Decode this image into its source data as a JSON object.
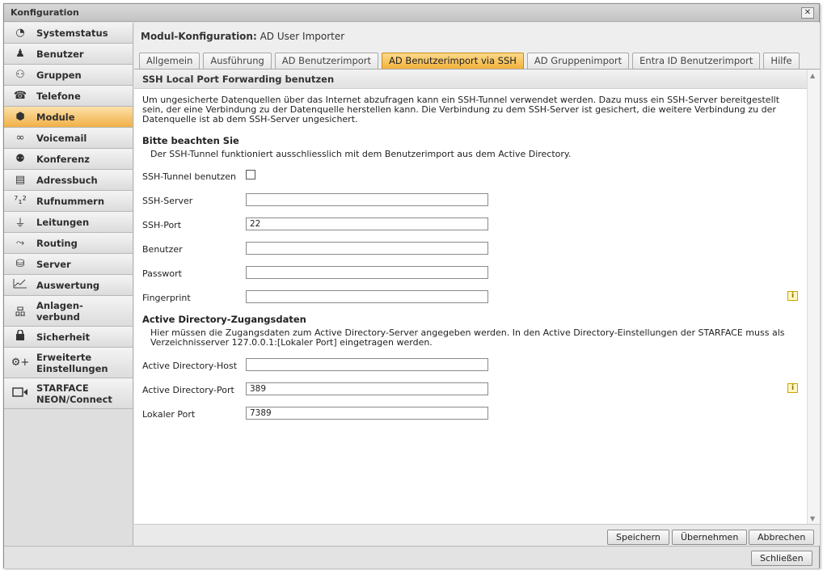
{
  "window": {
    "title": "Konfiguration",
    "close_glyph": "✕"
  },
  "sidebar": {
    "items": [
      {
        "label": "Systemstatus",
        "icon": "pie-chart-icon",
        "glyph": "◔"
      },
      {
        "label": "Benutzer",
        "icon": "user-icon",
        "glyph": "♟"
      },
      {
        "label": "Gruppen",
        "icon": "group-icon",
        "glyph": "⚇"
      },
      {
        "label": "Telefone",
        "icon": "phone-icon",
        "glyph": "☎"
      },
      {
        "label": "Module",
        "icon": "module-cube-icon",
        "glyph": "⬢"
      },
      {
        "label": "Voicemail",
        "icon": "voicemail-icon",
        "glyph": "∞"
      },
      {
        "label": "Konferenz",
        "icon": "conference-icon",
        "glyph": "⚉"
      },
      {
        "label": "Adressbuch",
        "icon": "address-book-icon",
        "glyph": "▤"
      },
      {
        "label": "Rufnummern",
        "icon": "phone-numbers-icon",
        "glyph": "⁷₁²"
      },
      {
        "label": "Leitungen",
        "icon": "lines-plug-icon",
        "glyph": "⏚"
      },
      {
        "label": "Routing",
        "icon": "routing-icon",
        "glyph": "⤳"
      },
      {
        "label": "Server",
        "icon": "server-icon",
        "glyph": "⛁"
      },
      {
        "label": "Auswertung",
        "icon": "statistics-icon",
        "glyph": "📈"
      },
      {
        "label": "Anlagen-\nverbund",
        "icon": "network-icon",
        "glyph": "品"
      },
      {
        "label": "Sicherheit",
        "icon": "lock-icon",
        "glyph": "🔒"
      },
      {
        "label": "Erweiterte\nEinstellungen",
        "icon": "advanced-settings-icon",
        "glyph": "⚙+"
      },
      {
        "label": "STARFACE\nNEON/Connect",
        "icon": "video-camera-icon",
        "glyph": "▭◁"
      }
    ]
  },
  "main": {
    "header_label": "Modul-Konfiguration:",
    "header_value": "AD User Importer",
    "tabs": [
      "Allgemein",
      "Ausführung",
      "AD Benutzerimport",
      "AD Benutzerimport via SSH",
      "AD Gruppenimport",
      "Entra ID Benutzerimport",
      "Hilfe"
    ],
    "active_tab": "AD Benutzerimport via SSH",
    "section_title": "SSH Local Port Forwarding benutzen",
    "intro": "Um ungesicherte Datenquellen über das Internet abzufragen kann ein SSH-Tunnel verwendet werden. Dazu muss ein SSH-Server bereitgestellt sein, der eine Verbindung zu der Datenquelle herstellen kann. Die Verbindung zu dem SSH-Server ist gesichert, die weitere Verbindung zu der Datenquelle ist ab dem SSH-Server ungesichert.",
    "notice_title": "Bitte beachten Sie",
    "notice_text": "Der SSH-Tunnel funktioniert ausschliesslich mit dem Benutzerimport aus dem Active Directory.",
    "ssh_tunnel_label": "SSH-Tunnel benutzen",
    "ssh_tunnel_checked": false,
    "fields": {
      "ssh_server": {
        "label": "SSH-Server",
        "value": ""
      },
      "ssh_port": {
        "label": "SSH-Port",
        "value": "22"
      },
      "user": {
        "label": "Benutzer",
        "value": ""
      },
      "password": {
        "label": "Passwort",
        "value": ""
      },
      "fingerprint": {
        "label": "Fingerprint",
        "value": ""
      },
      "ad_host": {
        "label": "Active Directory-Host",
        "value": ""
      },
      "ad_port": {
        "label": "Active Directory-Port",
        "value": "389"
      },
      "local_port": {
        "label": "Lokaler Port",
        "value": "7389"
      }
    },
    "ad_title": "Active Directory-Zugangsdaten",
    "ad_text": "Hier müssen die Zugangsdaten zum Active Directory-Server angegeben werden. In den Active Directory-Einstellungen der STARFACE muss als Verzeichnisserver 127.0.0.1:[Lokaler Port] eingetragen werden.",
    "info_glyph": "i",
    "buttons": {
      "save": "Speichern",
      "apply": "Übernehmen",
      "cancel": "Abbrechen"
    }
  },
  "footer": {
    "close": "Schließen"
  },
  "colors": {
    "active_accent": "#f2b23c",
    "active_light": "#fcd98b"
  }
}
